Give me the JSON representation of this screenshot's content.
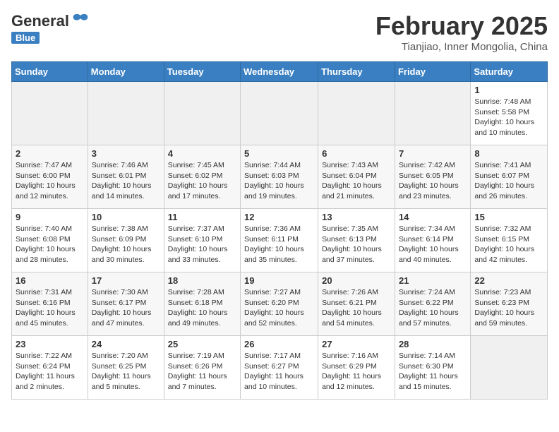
{
  "header": {
    "logo_general": "General",
    "logo_blue": "Blue",
    "month_title": "February 2025",
    "location": "Tianjiao, Inner Mongolia, China"
  },
  "days_of_week": [
    "Sunday",
    "Monday",
    "Tuesday",
    "Wednesday",
    "Thursday",
    "Friday",
    "Saturday"
  ],
  "weeks": [
    [
      {
        "day": "",
        "info": ""
      },
      {
        "day": "",
        "info": ""
      },
      {
        "day": "",
        "info": ""
      },
      {
        "day": "",
        "info": ""
      },
      {
        "day": "",
        "info": ""
      },
      {
        "day": "",
        "info": ""
      },
      {
        "day": "1",
        "info": "Sunrise: 7:48 AM\nSunset: 5:58 PM\nDaylight: 10 hours and 10 minutes."
      }
    ],
    [
      {
        "day": "2",
        "info": "Sunrise: 7:47 AM\nSunset: 6:00 PM\nDaylight: 10 hours and 12 minutes."
      },
      {
        "day": "3",
        "info": "Sunrise: 7:46 AM\nSunset: 6:01 PM\nDaylight: 10 hours and 14 minutes."
      },
      {
        "day": "4",
        "info": "Sunrise: 7:45 AM\nSunset: 6:02 PM\nDaylight: 10 hours and 17 minutes."
      },
      {
        "day": "5",
        "info": "Sunrise: 7:44 AM\nSunset: 6:03 PM\nDaylight: 10 hours and 19 minutes."
      },
      {
        "day": "6",
        "info": "Sunrise: 7:43 AM\nSunset: 6:04 PM\nDaylight: 10 hours and 21 minutes."
      },
      {
        "day": "7",
        "info": "Sunrise: 7:42 AM\nSunset: 6:05 PM\nDaylight: 10 hours and 23 minutes."
      },
      {
        "day": "8",
        "info": "Sunrise: 7:41 AM\nSunset: 6:07 PM\nDaylight: 10 hours and 26 minutes."
      }
    ],
    [
      {
        "day": "9",
        "info": "Sunrise: 7:40 AM\nSunset: 6:08 PM\nDaylight: 10 hours and 28 minutes."
      },
      {
        "day": "10",
        "info": "Sunrise: 7:38 AM\nSunset: 6:09 PM\nDaylight: 10 hours and 30 minutes."
      },
      {
        "day": "11",
        "info": "Sunrise: 7:37 AM\nSunset: 6:10 PM\nDaylight: 10 hours and 33 minutes."
      },
      {
        "day": "12",
        "info": "Sunrise: 7:36 AM\nSunset: 6:11 PM\nDaylight: 10 hours and 35 minutes."
      },
      {
        "day": "13",
        "info": "Sunrise: 7:35 AM\nSunset: 6:13 PM\nDaylight: 10 hours and 37 minutes."
      },
      {
        "day": "14",
        "info": "Sunrise: 7:34 AM\nSunset: 6:14 PM\nDaylight: 10 hours and 40 minutes."
      },
      {
        "day": "15",
        "info": "Sunrise: 7:32 AM\nSunset: 6:15 PM\nDaylight: 10 hours and 42 minutes."
      }
    ],
    [
      {
        "day": "16",
        "info": "Sunrise: 7:31 AM\nSunset: 6:16 PM\nDaylight: 10 hours and 45 minutes."
      },
      {
        "day": "17",
        "info": "Sunrise: 7:30 AM\nSunset: 6:17 PM\nDaylight: 10 hours and 47 minutes."
      },
      {
        "day": "18",
        "info": "Sunrise: 7:28 AM\nSunset: 6:18 PM\nDaylight: 10 hours and 49 minutes."
      },
      {
        "day": "19",
        "info": "Sunrise: 7:27 AM\nSunset: 6:20 PM\nDaylight: 10 hours and 52 minutes."
      },
      {
        "day": "20",
        "info": "Sunrise: 7:26 AM\nSunset: 6:21 PM\nDaylight: 10 hours and 54 minutes."
      },
      {
        "day": "21",
        "info": "Sunrise: 7:24 AM\nSunset: 6:22 PM\nDaylight: 10 hours and 57 minutes."
      },
      {
        "day": "22",
        "info": "Sunrise: 7:23 AM\nSunset: 6:23 PM\nDaylight: 10 hours and 59 minutes."
      }
    ],
    [
      {
        "day": "23",
        "info": "Sunrise: 7:22 AM\nSunset: 6:24 PM\nDaylight: 11 hours and 2 minutes."
      },
      {
        "day": "24",
        "info": "Sunrise: 7:20 AM\nSunset: 6:25 PM\nDaylight: 11 hours and 5 minutes."
      },
      {
        "day": "25",
        "info": "Sunrise: 7:19 AM\nSunset: 6:26 PM\nDaylight: 11 hours and 7 minutes."
      },
      {
        "day": "26",
        "info": "Sunrise: 7:17 AM\nSunset: 6:27 PM\nDaylight: 11 hours and 10 minutes."
      },
      {
        "day": "27",
        "info": "Sunrise: 7:16 AM\nSunset: 6:29 PM\nDaylight: 11 hours and 12 minutes."
      },
      {
        "day": "28",
        "info": "Sunrise: 7:14 AM\nSunset: 6:30 PM\nDaylight: 11 hours and 15 minutes."
      },
      {
        "day": "",
        "info": ""
      }
    ]
  ]
}
